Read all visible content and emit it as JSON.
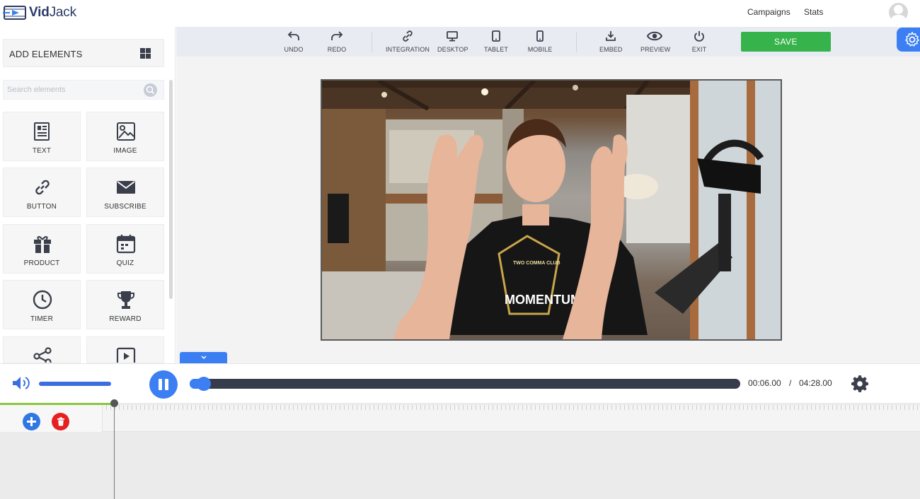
{
  "app": {
    "brand_bold": "Vid",
    "brand_light": "Jack"
  },
  "topnav": {
    "campaigns": "Campaigns",
    "stats": "Stats"
  },
  "sidebar": {
    "header": "ADD ELEMENTS",
    "search_placeholder": "Search elements",
    "elements": [
      {
        "label": "TEXT",
        "icon": "text-icon"
      },
      {
        "label": "IMAGE",
        "icon": "image-icon"
      },
      {
        "label": "BUTTON",
        "icon": "link-icon"
      },
      {
        "label": "SUBSCRIBE",
        "icon": "envelope-icon"
      },
      {
        "label": "PRODUCT",
        "icon": "gift-icon"
      },
      {
        "label": "QUIZ",
        "icon": "calendar-icon"
      },
      {
        "label": "TIMER",
        "icon": "clock-icon"
      },
      {
        "label": "REWARD",
        "icon": "trophy-icon"
      },
      {
        "label": "",
        "icon": "share-icon"
      },
      {
        "label": "",
        "icon": "video-play-icon"
      }
    ]
  },
  "toolbar": {
    "undo": "UNDO",
    "redo": "REDO",
    "integration": "INTEGRATION",
    "desktop": "DESKTOP",
    "tablet": "TABLET",
    "mobile": "MOBILE",
    "embed": "EMBED",
    "preview": "PREVIEW",
    "exit": "EXIT",
    "save": "SAVE"
  },
  "video": {
    "shirt_text": "MOMENTUM",
    "shirt_top_text": "TWO COMMA CLUB"
  },
  "player": {
    "current_time": "00:06.00",
    "separator": "/",
    "duration": "04:28.00",
    "progress_fraction": 0.02,
    "volume_fraction": 1.0
  },
  "colors": {
    "accent": "#3b7ff2",
    "save": "#36b34a",
    "delete": "#e52020",
    "timeline_green": "#8cc63f"
  }
}
